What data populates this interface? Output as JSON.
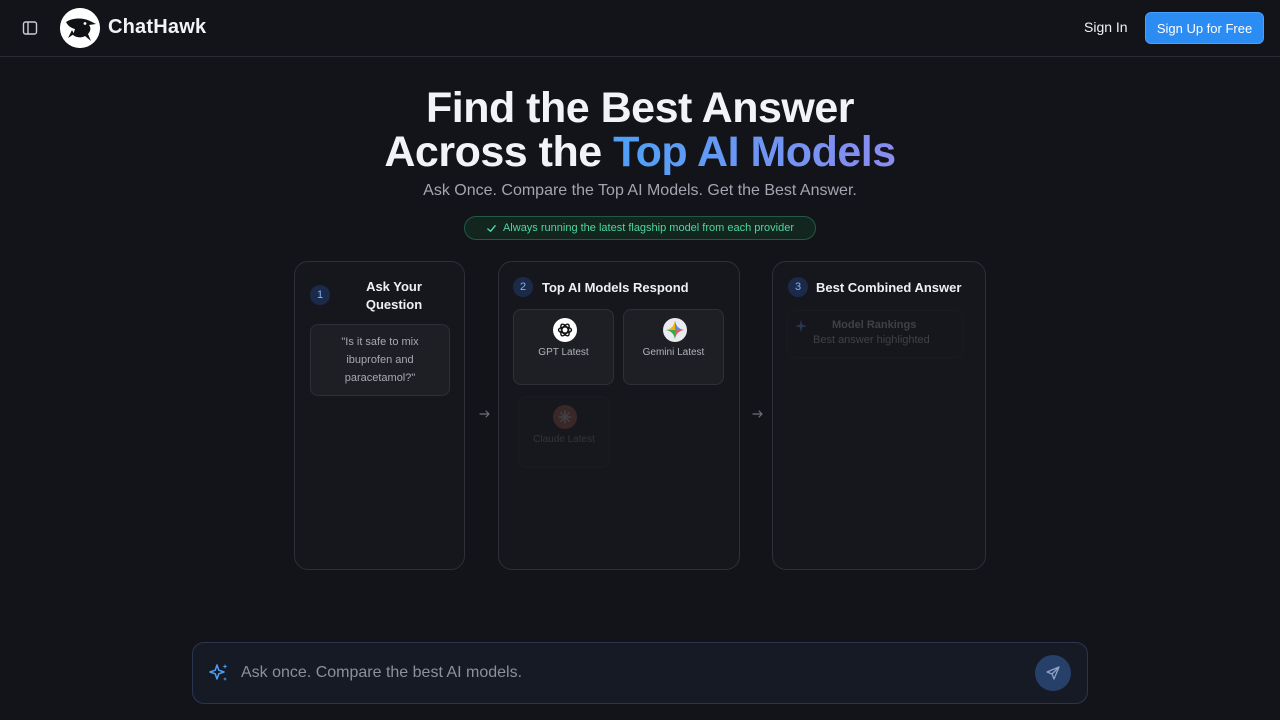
{
  "header": {
    "brand": "ChatHawk",
    "sign_in": "Sign In",
    "sign_up": "Sign Up for Free"
  },
  "hero": {
    "title_line1": "Find the Best Answer",
    "title_line2_plain": "Across the ",
    "title_line2_accent": "Top AI Models",
    "subtitle": "Ask Once. Compare the Top AI Models. Get the Best Answer.",
    "badge": "Always running the latest flagship model from each provider"
  },
  "steps": [
    {
      "number": "1",
      "title": "Ask Your Question",
      "question": "\"Is it safe to mix ibuprofen and paracetamol?\""
    },
    {
      "number": "2",
      "title": "Top AI Models Respond",
      "models": [
        {
          "label": "GPT Latest",
          "icon": "openai-icon"
        },
        {
          "label": "Gemini Latest",
          "icon": "gemini-icon"
        },
        {
          "label": "Claude Latest",
          "icon": "claude-icon"
        }
      ]
    },
    {
      "number": "3",
      "title": "Best Combined Answer",
      "rankings_title": "Model Rankings",
      "rankings_sub": "Best answer highlighted"
    }
  ],
  "ask_bar": {
    "placeholder": "Ask once. Compare the best AI models."
  },
  "colors": {
    "background": "#131419",
    "accent": "#2b8cf3",
    "badge_green": "#4fd6a0"
  }
}
